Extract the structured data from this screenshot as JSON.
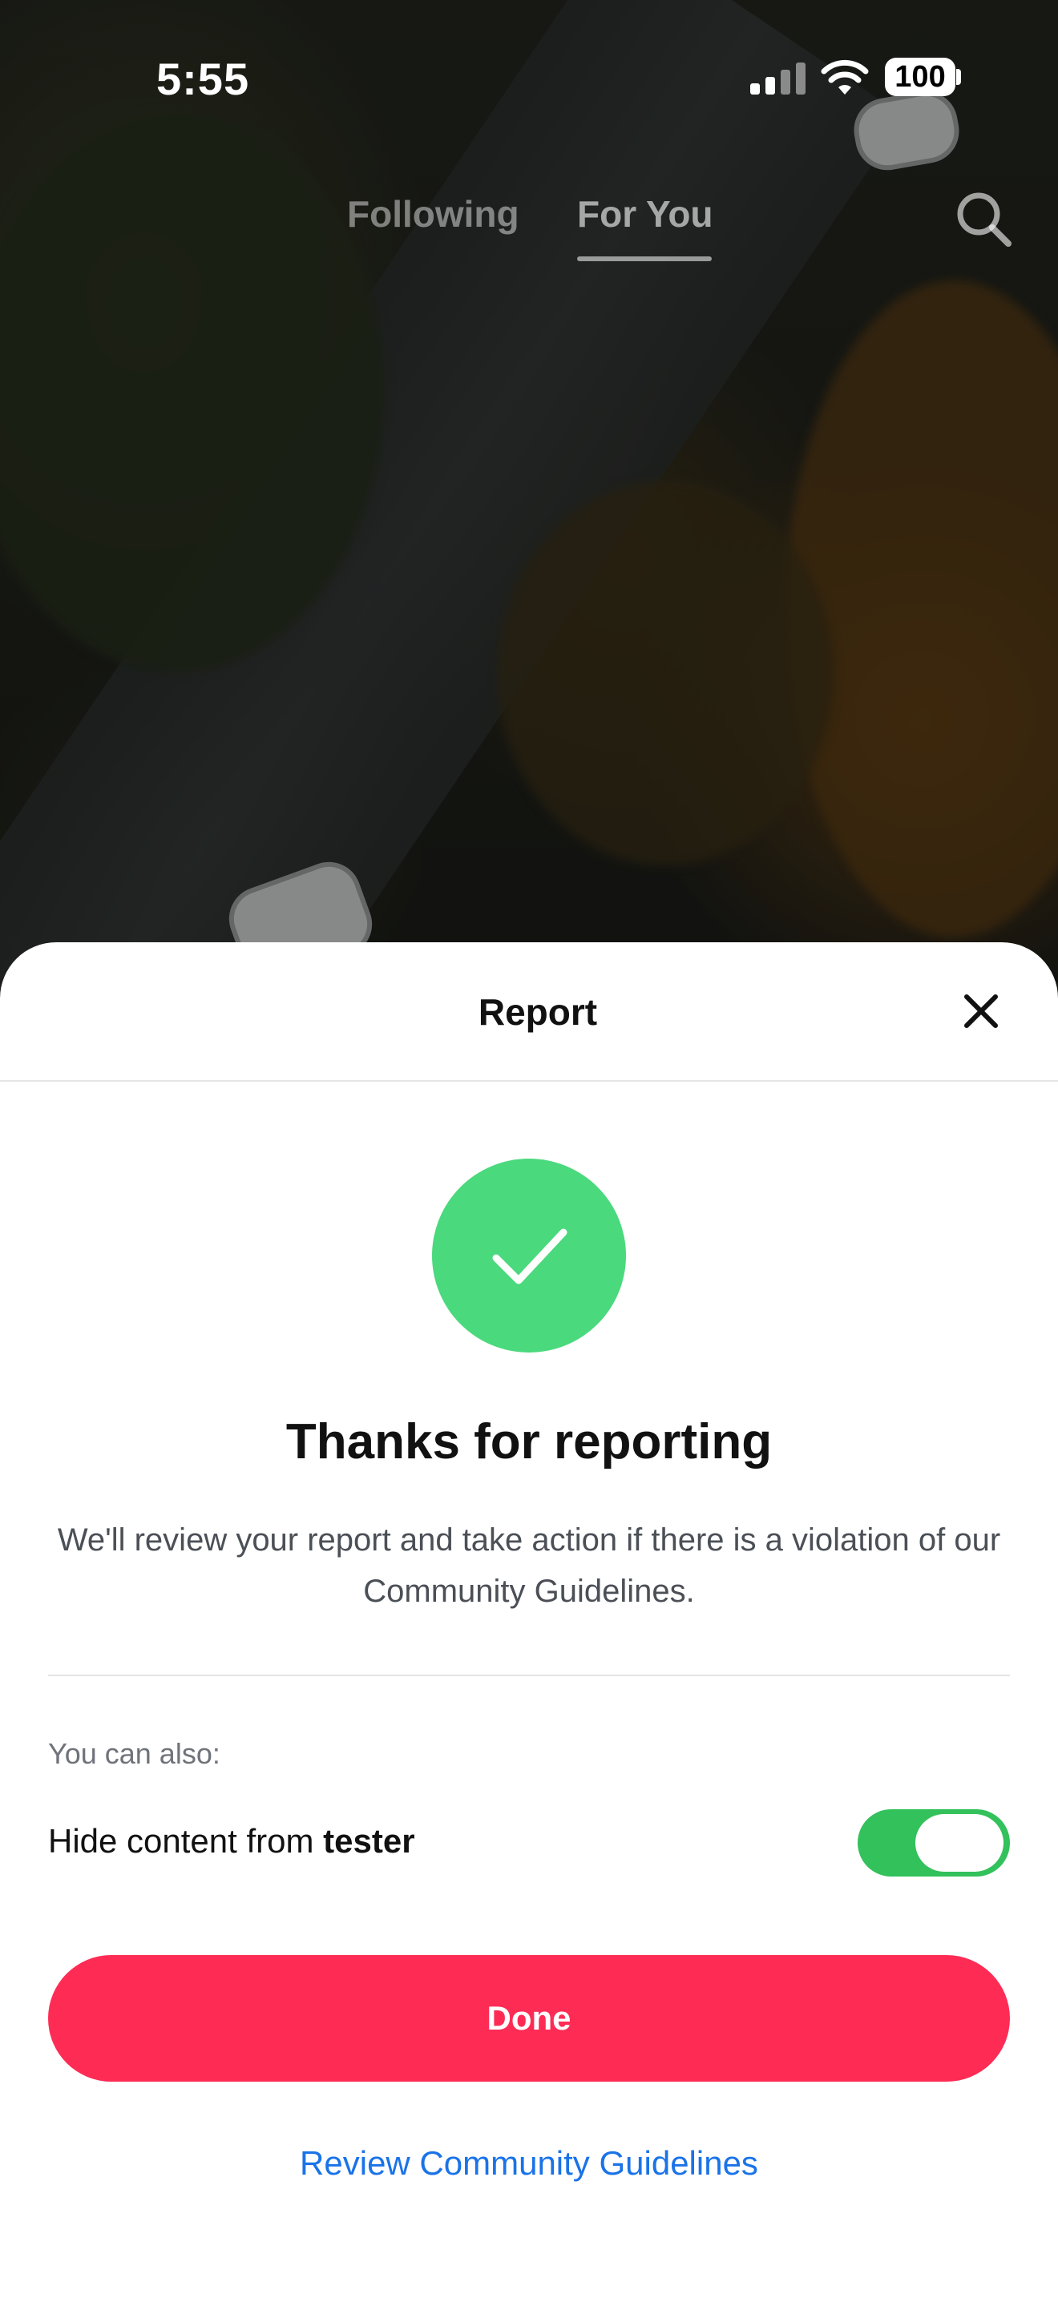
{
  "status_bar": {
    "time": "5:55",
    "battery": "100",
    "icons": [
      "cellular-signal-icon",
      "wifi-icon",
      "battery-icon"
    ]
  },
  "top_nav": {
    "tabs": [
      {
        "label": "Following",
        "active": false
      },
      {
        "label": "For You",
        "active": true
      }
    ],
    "search_icon": "search-icon"
  },
  "sheet": {
    "title": "Report",
    "close_icon": "close-icon",
    "check_icon": "checkmark-icon",
    "heading": "Thanks for reporting",
    "description": "We'll review your report and take action if there is a violation of our Community Guidelines.",
    "also_label": "You can also:",
    "hide_prefix": "Hide content from ",
    "hide_user": "tester",
    "hide_toggle_on": true,
    "done_label": "Done",
    "guidelines_link": "Review Community Guidelines"
  },
  "colors": {
    "accent_red": "#fe2c55",
    "success_green": "#4ad97d",
    "toggle_green": "#33c15b",
    "link_blue": "#1a73e8"
  }
}
